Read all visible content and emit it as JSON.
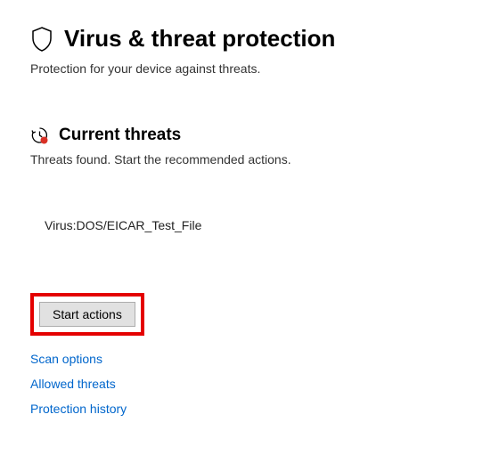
{
  "header": {
    "title": "Virus & threat protection",
    "subtitle": "Protection for your device against threats."
  },
  "current_threats": {
    "title": "Current threats",
    "subtitle": "Threats found. Start the recommended actions.",
    "items": [
      "Virus:DOS/EICAR_Test_File"
    ]
  },
  "buttons": {
    "start_actions": "Start actions"
  },
  "links": {
    "scan_options": "Scan options",
    "allowed_threats": "Allowed threats",
    "protection_history": "Protection history"
  }
}
